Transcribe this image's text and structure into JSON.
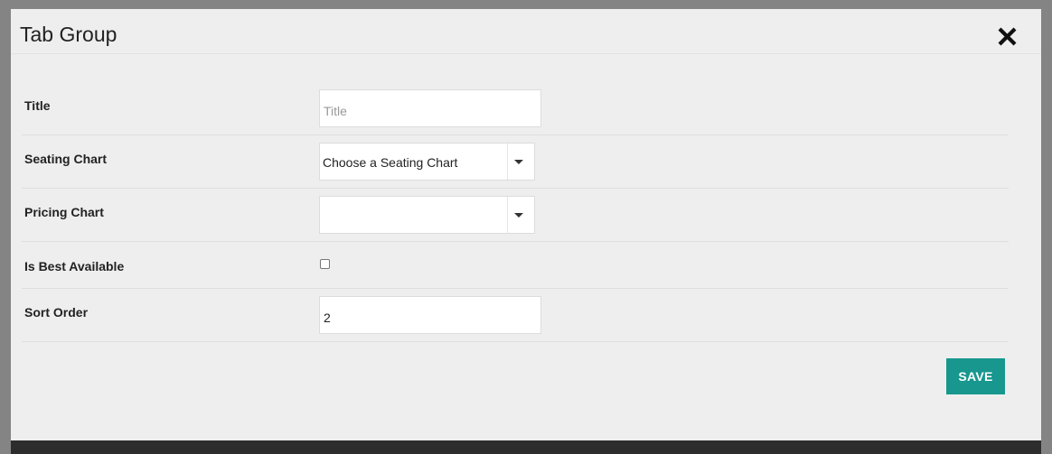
{
  "modal": {
    "title": "Tab Group",
    "close_icon": "close-icon"
  },
  "form": {
    "title": {
      "label": "Title",
      "value": "",
      "placeholder": "Title"
    },
    "seating_chart": {
      "label": "Seating Chart",
      "selected": "Choose a Seating Chart"
    },
    "pricing_chart": {
      "label": "Pricing Chart",
      "selected": ""
    },
    "is_best_available": {
      "label": "Is Best Available",
      "checked": false
    },
    "sort_order": {
      "label": "Sort Order",
      "value": "2"
    }
  },
  "actions": {
    "save_label": "SAVE"
  },
  "colors": {
    "overlay": "#848484",
    "modal_bg": "#eeeeee",
    "accent": "#17978e"
  }
}
